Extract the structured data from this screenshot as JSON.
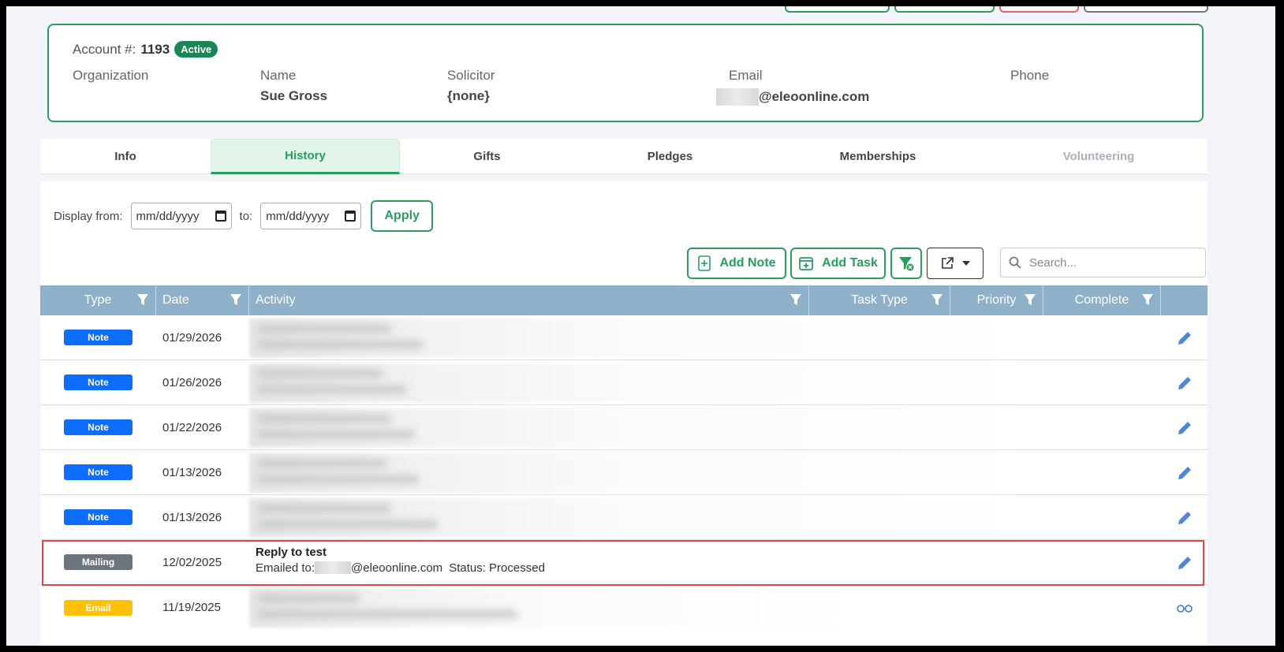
{
  "account": {
    "label": "Account #:",
    "number": "1193",
    "status": "Active",
    "fields": [
      {
        "label": "Organization",
        "value": ""
      },
      {
        "label": "Name",
        "value": "Sue Gross"
      },
      {
        "label": "Solicitor",
        "value": "{none}"
      },
      {
        "label": "Email",
        "value": "@eleoonline.com"
      },
      {
        "label": "Phone",
        "value": ""
      }
    ]
  },
  "tabs": [
    {
      "label": "Info"
    },
    {
      "label": "History"
    },
    {
      "label": "Gifts"
    },
    {
      "label": "Pledges"
    },
    {
      "label": "Memberships"
    },
    {
      "label": "Volunteering"
    }
  ],
  "filter": {
    "display_from_label": "Display from:",
    "from_placeholder": "mm/dd/yyyy",
    "to_label": "to:",
    "to_placeholder": "mm/dd/yyyy",
    "apply_label": "Apply"
  },
  "toolbar": {
    "add_note_label": "Add Note",
    "add_task_label": "Add Task",
    "search_placeholder": "Search..."
  },
  "table": {
    "columns": [
      "Type",
      "Date",
      "Activity",
      "Task Type",
      "Priority",
      "Complete"
    ],
    "rows": [
      {
        "type": "Note",
        "date": "01/29/2026"
      },
      {
        "type": "Note",
        "date": "01/26/2026"
      },
      {
        "type": "Note",
        "date": "01/22/2026"
      },
      {
        "type": "Note",
        "date": "01/13/2026"
      },
      {
        "type": "Note",
        "date": "01/13/2026"
      },
      {
        "type": "Mailing",
        "date": "12/02/2025",
        "activity_title": "Reply to test",
        "activity_prefix": "Emailed to:",
        "activity_email": "@eleoonline.com",
        "activity_status": "Status: Processed"
      },
      {
        "type": "Email",
        "date": "11/19/2025"
      }
    ]
  },
  "colors": {
    "accent": "#2a9d5c",
    "note_badge": "#0d6efd",
    "mailing_badge": "#6c757d",
    "email_badge": "#ffc107",
    "header_bg": "#8fb0c9",
    "highlight": "#e0474c"
  }
}
